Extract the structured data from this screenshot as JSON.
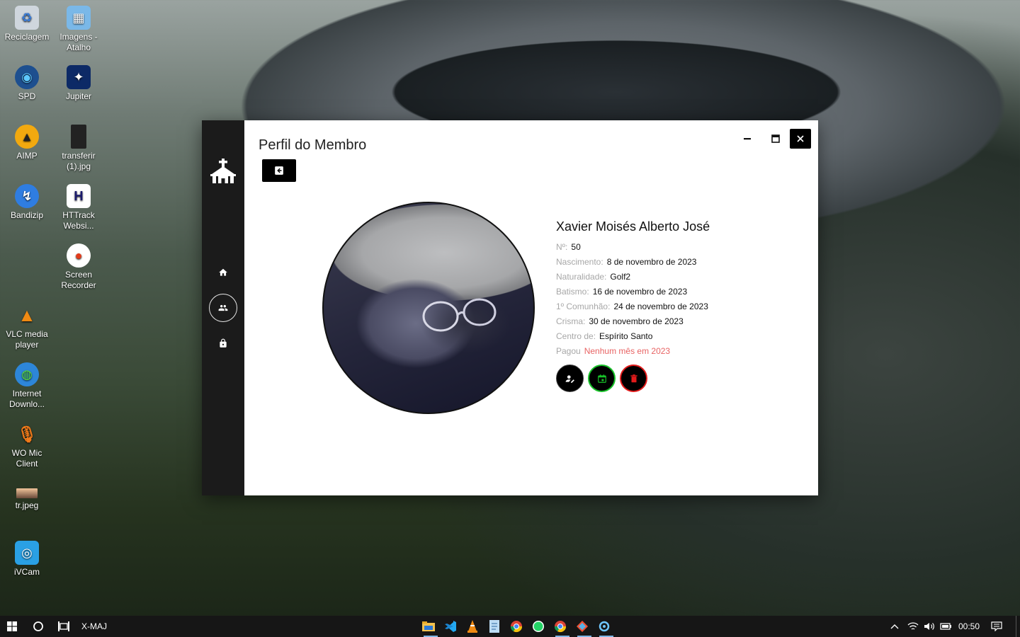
{
  "desktop": {
    "icons": [
      {
        "label": "Reciclagem"
      },
      {
        "label": "Imagens - Atalho"
      },
      {
        "label": "SPD"
      },
      {
        "label": "Jupiter"
      },
      {
        "label": "AIMP"
      },
      {
        "label": "transferir (1).jpg"
      },
      {
        "label": "Bandizip"
      },
      {
        "label": "HTTrack Websi..."
      },
      {
        "label": "Screen Recorder"
      },
      {
        "label": "VLC media player"
      },
      {
        "label": "Internet Downlo..."
      },
      {
        "label": "WO Mic Client"
      },
      {
        "label": "tr.jpeg"
      },
      {
        "label": "iVCam"
      }
    ]
  },
  "window": {
    "title": "Perfil do Membro"
  },
  "member": {
    "name": "Xavier Moisés Alberto José",
    "fields": [
      {
        "label": "Nº:",
        "value": "50"
      },
      {
        "label": "Nascimento:",
        "value": "8 de novembro de 2023"
      },
      {
        "label": "Naturalidade:",
        "value": "Golf2"
      },
      {
        "label": "Batismo:",
        "value": "16 de novembro de 2023"
      },
      {
        "label": "1º Comunhão:",
        "value": "24 de novembro de 2023"
      },
      {
        "label": "Crisma:",
        "value": "30 de novembro de 2023"
      },
      {
        "label": "Centro de:",
        "value": "Espírito Santo"
      },
      {
        "label": "Pagou",
        "value": "Nenhum mês em 2023"
      }
    ]
  },
  "taskbar": {
    "search_text": "X-MAJ",
    "clock": "00:50"
  },
  "colors": {
    "sidebar": "#1b1b1b",
    "accent_green": "#18c229",
    "accent_red": "#e21b1b",
    "warning_text": "#e86464"
  }
}
